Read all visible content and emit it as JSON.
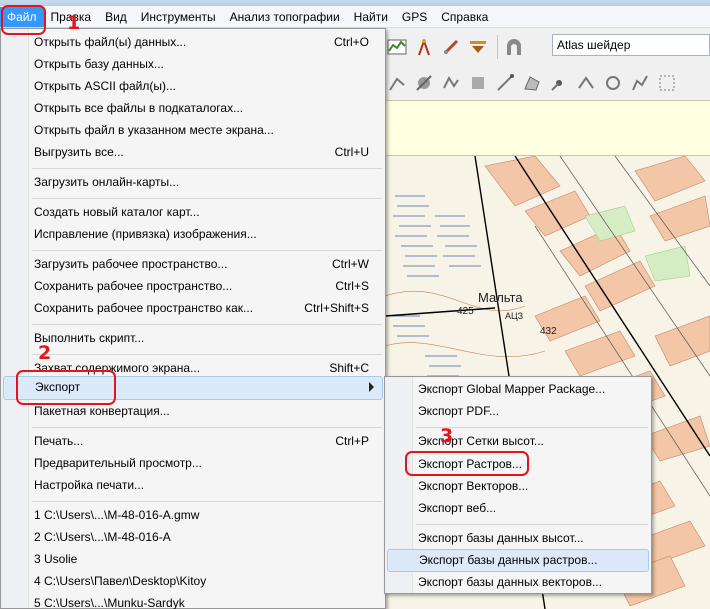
{
  "menubar": {
    "items": [
      "Файл",
      "Правка",
      "Вид",
      "Инструменты",
      "Анализ топографии",
      "Найти",
      "GPS",
      "Справка"
    ]
  },
  "toolbar": {
    "shader_value": "Atlas шейдер"
  },
  "file_menu": {
    "items": [
      {
        "label": "Открыть файл(ы) данных...",
        "shortcut": "Ctrl+O"
      },
      {
        "label": "Открыть базу данных...",
        "shortcut": ""
      },
      {
        "label": "Открыть ASCII файл(ы)...",
        "shortcut": ""
      },
      {
        "label": "Открыть все файлы в подкаталогах...",
        "shortcut": ""
      },
      {
        "label": "Открыть файл в указанном месте экрана...",
        "shortcut": ""
      },
      {
        "label": "Выгрузить все...",
        "shortcut": "Ctrl+U"
      },
      {
        "label": "Загрузить онлайн-карты...",
        "shortcut": ""
      },
      {
        "label": "Создать новый каталог карт...",
        "shortcut": ""
      },
      {
        "label": "Исправление (привязка) изображения...",
        "shortcut": ""
      },
      {
        "label": "Загрузить рабочее пространство...",
        "shortcut": "Ctrl+W"
      },
      {
        "label": "Сохранить рабочее пространство...",
        "shortcut": "Ctrl+S"
      },
      {
        "label": "Сохранить рабочее пространство как...",
        "shortcut": "Ctrl+Shift+S"
      },
      {
        "label": "Выполнить скрипт...",
        "shortcut": ""
      },
      {
        "label": "Захват содержимого экрана...",
        "shortcut": "Shift+C"
      },
      {
        "label": "Экспорт",
        "shortcut": ""
      },
      {
        "label": "Пакетная конвертация...",
        "shortcut": ""
      },
      {
        "label": "Печать...",
        "shortcut": "Ctrl+P"
      },
      {
        "label": "Предварительный просмотр...",
        "shortcut": ""
      },
      {
        "label": "Настройка печати...",
        "shortcut": ""
      },
      {
        "label": "1 C:\\Users\\...\\M-48-016-A.gmw",
        "shortcut": ""
      },
      {
        "label": "2 C:\\Users\\...\\M-48-016-A",
        "shortcut": ""
      },
      {
        "label": "3 Usolie",
        "shortcut": ""
      },
      {
        "label": "4 C:\\Users\\Павел\\Desktop\\Kitoy",
        "shortcut": ""
      },
      {
        "label": "5 C:\\Users\\...\\Munku-Sardyk",
        "shortcut": ""
      }
    ]
  },
  "export_submenu": {
    "items": [
      "Экспорт Global Mapper Package...",
      "Экспорт PDF...",
      "Экспорт Сетки высот...",
      "Экспорт Растров...",
      "Экспорт Векторов...",
      "Экспорт веб...",
      "Экспорт базы данных высот...",
      "Экспорт базы данных растров...",
      "Экспорт базы данных векторов..."
    ]
  },
  "map": {
    "place_name": "Мальта",
    "labels": [
      "425",
      "АЦЗ",
      "432"
    ]
  },
  "annotations": {
    "step1": "1",
    "step2": "2",
    "step3": "3",
    "color": "#e3141b"
  }
}
